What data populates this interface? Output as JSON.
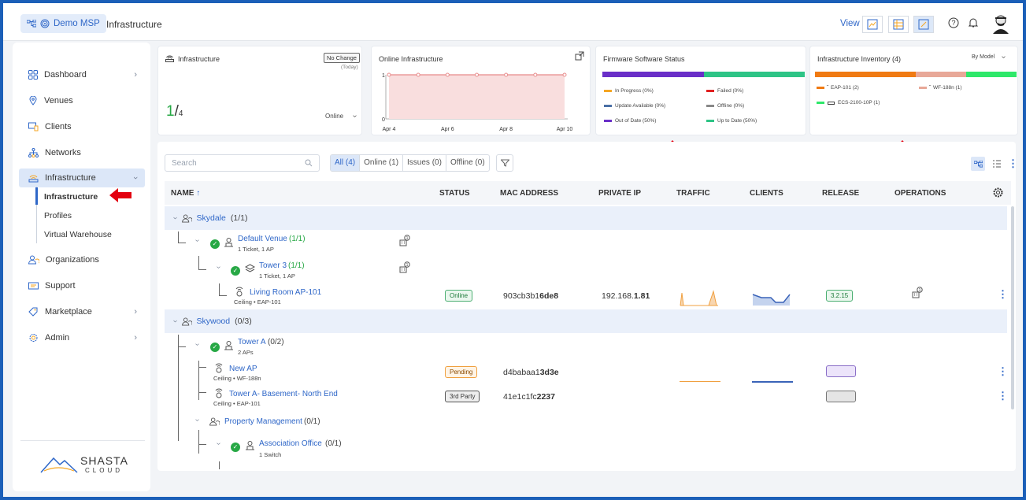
{
  "topbar": {
    "brand": "Demo MSP",
    "title": "Infrastructure",
    "view_label": "View"
  },
  "sidebar": {
    "items": [
      {
        "label": "Dashboard"
      },
      {
        "label": "Venues"
      },
      {
        "label": "Clients"
      },
      {
        "label": "Networks"
      },
      {
        "label": "Infrastructure"
      },
      {
        "label": "Organizations"
      },
      {
        "label": "Support"
      },
      {
        "label": "Marketplace"
      },
      {
        "label": "Admin"
      }
    ],
    "sub_items": [
      "Infrastructure",
      "Profiles",
      "Virtual Warehouse"
    ],
    "logo_text": "SHASTA",
    "logo_sub": "CLOUD"
  },
  "cards": {
    "infra": {
      "title": "Infrastructure",
      "badge": "No Change",
      "badge_sub": "(Today)",
      "value_num": "1",
      "value_den": "4",
      "filter": "Online"
    },
    "online": {
      "title": "Online Infrastructure",
      "y_max": "1",
      "y_min": "0",
      "x_labels": [
        "Apr 4",
        "Apr 6",
        "Apr 8",
        "Apr 10"
      ]
    },
    "firmware": {
      "title": "Firmware Software Status",
      "legend": [
        {
          "label": "In Progress (0%)",
          "color": "#f5a623"
        },
        {
          "label": "Failed (0%)",
          "color": "#e02020"
        },
        {
          "label": "Update Available (0%)",
          "color": "#4a6fa5"
        },
        {
          "label": "Offline (0%)",
          "color": "#888888"
        },
        {
          "label": "Out of Date (50%)",
          "color": "#6a2fc8"
        },
        {
          "label": "Up to Date (50%)",
          "color": "#2ec486"
        }
      ]
    },
    "inventory": {
      "title": "Infrastructure Inventory (4)",
      "by": "By Model",
      "legend": [
        {
          "label": "EAP-101 (2)",
          "color": "#f07a12"
        },
        {
          "label": "WF-188n (1)",
          "color": "#e8a898"
        },
        {
          "label": "ECS-2100-10P (1)",
          "color": "#2ee86a"
        }
      ]
    }
  },
  "chart_data": {
    "type": "line",
    "title": "Online Infrastructure",
    "x": [
      "Apr 4",
      "Apr 5",
      "Apr 6",
      "Apr 7",
      "Apr 8",
      "Apr 9",
      "Apr 10"
    ],
    "series": [
      {
        "values": [
          1,
          1,
          1,
          1,
          1,
          1,
          1
        ]
      }
    ],
    "ylim": [
      0,
      1
    ]
  },
  "toolbar": {
    "search_placeholder": "Search",
    "filters": [
      "All (4)",
      "Online (1)",
      "Issues (0)",
      "Offline (0)"
    ]
  },
  "table": {
    "columns": [
      "NAME",
      "STATUS",
      "MAC ADDRESS",
      "PRIVATE IP",
      "TRAFFIC",
      "CLIENTS",
      "RELEASE",
      "OPERATIONS"
    ],
    "groups": [
      {
        "name": "Skydale",
        "count": "(1/1)"
      },
      {
        "name": "Skywood",
        "count": "(0/3)"
      }
    ],
    "rows": {
      "default_venue": {
        "name": "Default Venue",
        "count": "(1/1)",
        "sub": "1 Ticket, 1 AP"
      },
      "tower3": {
        "name": "Tower 3",
        "count": "(1/1)",
        "sub": "1 Ticket, 1 AP"
      },
      "living_room": {
        "name": "Living Room AP-101",
        "sub": "Ceiling • EAP-101",
        "status": "Online",
        "mac_a": "903cb3b1",
        "mac_b": "6de8",
        "ip_a": "192.168.",
        "ip_b": "1.81",
        "release": "3.2.15"
      },
      "tower_a": {
        "name": "Tower A",
        "count": "(0/2)",
        "sub": "2 APs"
      },
      "new_ap": {
        "name": "New AP",
        "sub": "Ceiling • WF-188n",
        "status": "Pending",
        "mac_a": "d4babaa1",
        "mac_b": "3d3e"
      },
      "tower_a_basement": {
        "name": "Tower A- Basement- North End",
        "sub": "Ceiling • EAP-101",
        "status": "3rd Party",
        "mac_a": "41e1c1fc",
        "mac_b": "2237"
      },
      "property_mgmt": {
        "name": "Property Management",
        "count": "(0/1)"
      },
      "association_office": {
        "name": "Association Office",
        "count": "(0/1)",
        "sub": "1 Switch"
      }
    }
  }
}
